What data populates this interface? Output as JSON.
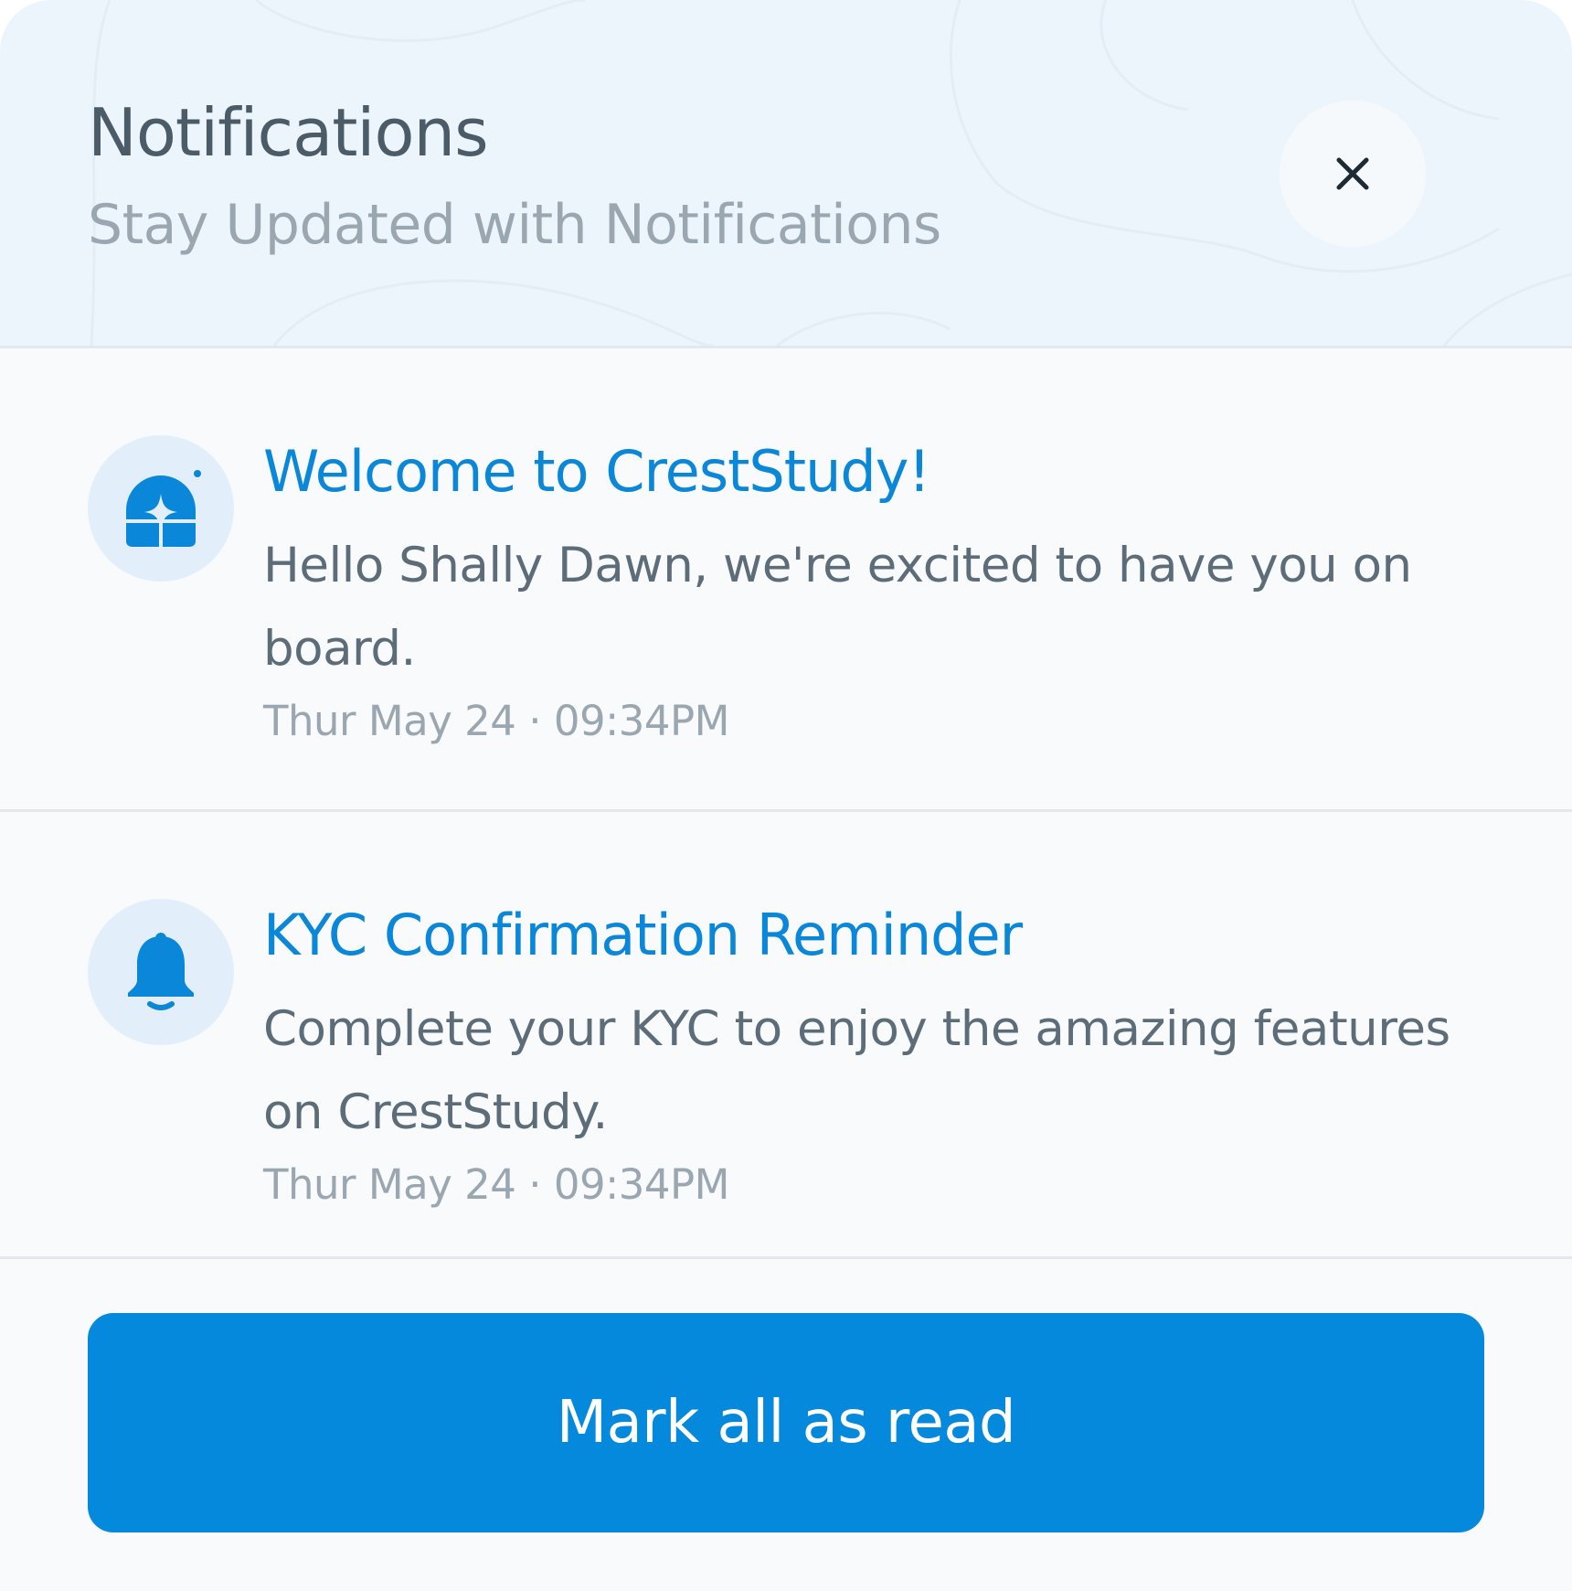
{
  "header": {
    "title": "Notifications",
    "subtitle": "Stay Updated with Notifications",
    "close_icon": "close-icon"
  },
  "notifications": [
    {
      "icon": "sparkle-house-icon",
      "title": "Welcome to CrestStudy!",
      "body": "Hello Shally Dawn, we're excited to have you on board.",
      "time": "Thur May 24 · 09:34PM"
    },
    {
      "icon": "bell-icon",
      "title": "KYC Confirmation Reminder",
      "body": "Complete your KYC to enjoy the amazing features on CrestStudy.",
      "time": "Thur May 24 · 09:34PM"
    }
  ],
  "footer": {
    "mark_all_label": "Mark all as read"
  },
  "colors": {
    "accent": "#0589dd",
    "title_blue": "#0a87d9",
    "header_bg": "#edf5fc",
    "icon_bg": "#e2effb"
  }
}
